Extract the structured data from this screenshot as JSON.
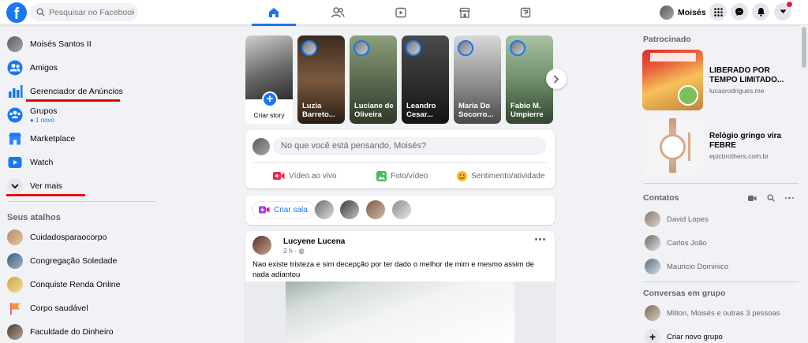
{
  "header": {
    "search_placeholder": "Pesquisar no Facebook",
    "logo_letter": "f",
    "user_name": "Moisés"
  },
  "sidebar": {
    "items": [
      {
        "label": "Moisés Santos II",
        "icon": "avatar"
      },
      {
        "label": "Amigos",
        "icon": "friends-icon"
      },
      {
        "label": "Gerenciador de Anúncios",
        "icon": "ads-manager-icon"
      },
      {
        "label": "Grupos",
        "sub": "● 1 novo",
        "icon": "groups-icon"
      },
      {
        "label": "Marketplace",
        "icon": "marketplace-icon"
      },
      {
        "label": "Watch",
        "icon": "watch-icon"
      },
      {
        "label": "Ver mais",
        "icon": "chevron-down-icon"
      }
    ],
    "shortcuts_title": "Seus atalhos",
    "shortcuts": [
      {
        "label": "Cuidadosparaocorpo"
      },
      {
        "label": "Congregação Soledade"
      },
      {
        "label": "Conquiste Renda Online"
      },
      {
        "label": "Corpo saudável"
      },
      {
        "label": "Faculdade do Dinheiro"
      }
    ]
  },
  "stories": {
    "create_label": "Criar story",
    "items": [
      {
        "name": "Luzia Barreto...",
        "color": "#7a5a3e"
      },
      {
        "name": "Luciane de Oliveira",
        "color": "#5d6a52"
      },
      {
        "name": "Leandro Cesar...",
        "color": "#2e3030"
      },
      {
        "name": "Maria Do Socorro...",
        "color": "#8d8d8d"
      },
      {
        "name": "Fabio M. Umpierre",
        "color": "#6f8f6a"
      }
    ]
  },
  "composer": {
    "placeholder": "No que você está pensando, Moisés?",
    "actions": [
      {
        "label": "Vídeo ao vivo",
        "color": "#f02849"
      },
      {
        "label": "Foto/vídeo",
        "color": "#45bd62"
      },
      {
        "label": "Sentimento/atividade",
        "color": "#f7b928"
      }
    ]
  },
  "rooms": {
    "create_label": "Criar sala"
  },
  "post": {
    "author": "Lucyene Lucena",
    "meta": "2 h · ◍",
    "text": "Nao existe tristeza e sim decepção  por ter dado o melhor de mim e mesmo assim de nada adiantou"
  },
  "right": {
    "sponsored_title": "Patrocinado",
    "ads": [
      {
        "title": "LIBERADO POR TEMPO LIMITADO...",
        "domain": "lucasrodrigues.me"
      },
      {
        "title": "Relógio gringo vira FEBRE",
        "domain": "epicbrothers.com.br"
      }
    ],
    "contacts_title": "Contatos",
    "contacts": [
      "David Lopes",
      "Carlos João",
      "Mauricio Dominico"
    ],
    "group_convos_title": "Conversas em grupo",
    "group_convo": "Milton, Moisés e outras 3 pessoas",
    "new_group": "Criar novo grupo"
  },
  "colors": {
    "brand": "#1877f2",
    "annotation_red": "#e00000"
  }
}
